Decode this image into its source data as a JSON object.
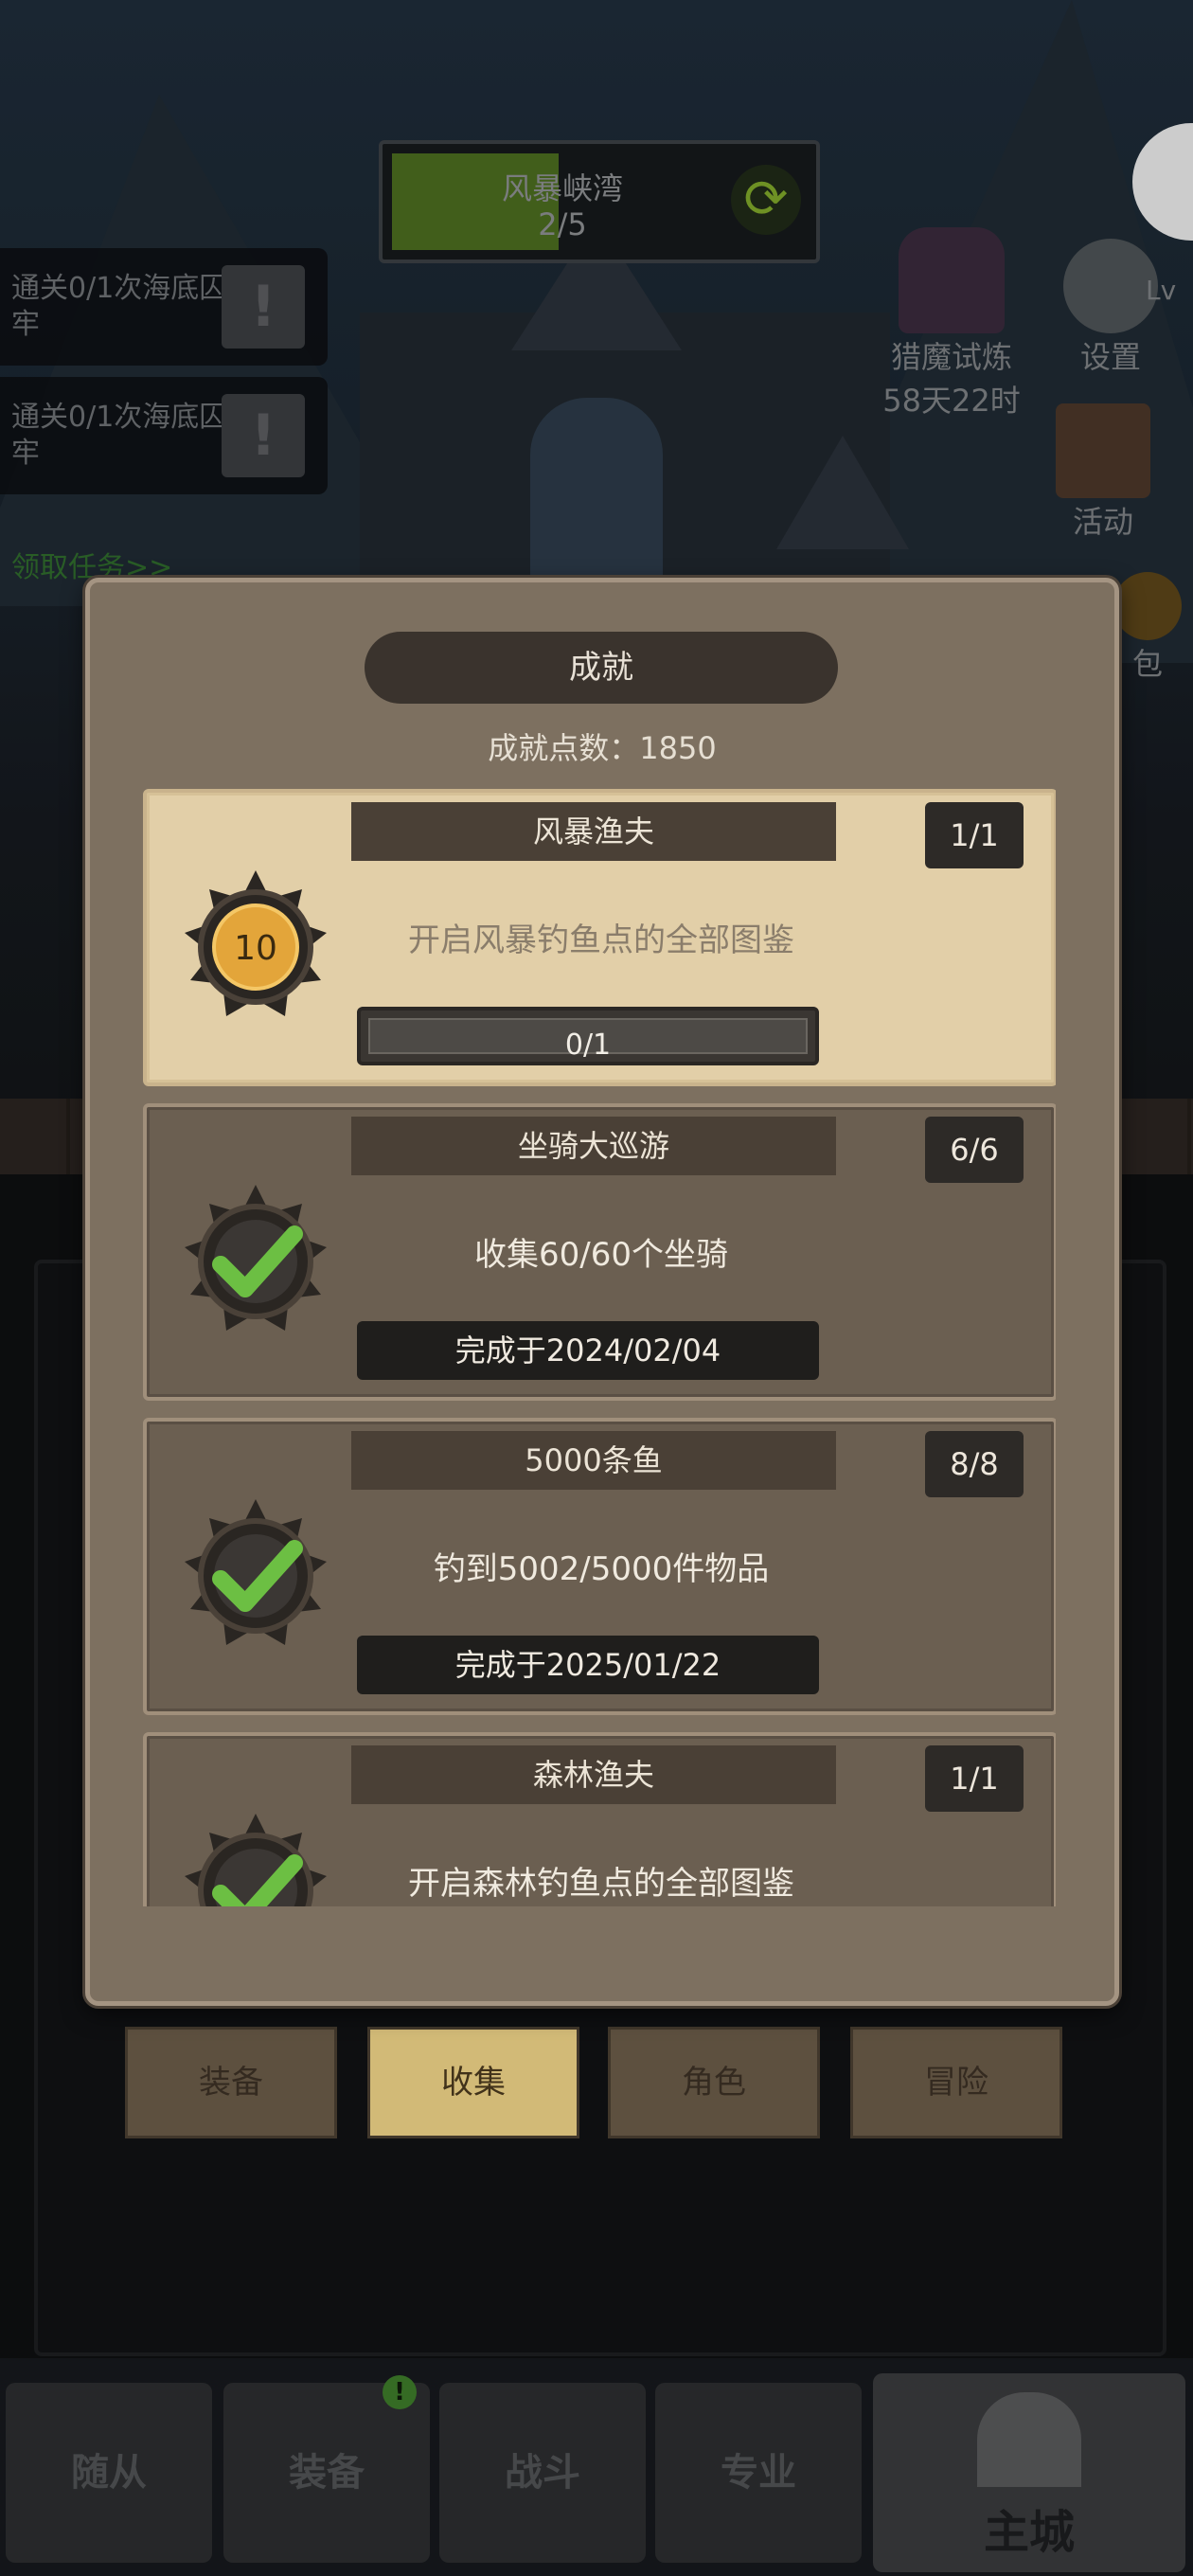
{
  "hud": {
    "map_name": "风暴峡湾",
    "map_progress": "2/5",
    "map_progress_fraction": 0.4,
    "quests": [
      {
        "text": "通关0/1次海底囚牢"
      },
      {
        "text": "通关0/1次海底囚牢"
      }
    ],
    "quest_link": "领取任务>>",
    "trial": {
      "name": "猎魔试炼",
      "time": "58天22时"
    },
    "settings_label": "设置",
    "activity_label": "活动",
    "level_prefix": "Lv",
    "bag_partial_label": "包"
  },
  "modal": {
    "title": "成就",
    "points_label": "成就点数：",
    "points_value": "1850",
    "achievements": [
      {
        "title": "风暴渔夫",
        "count": "1/1",
        "description": "开启风暴钓鱼点的全部图鉴",
        "state": "in-progress",
        "medal_value": "10",
        "progress_text": "0/1",
        "progress_fraction": 0
      },
      {
        "title": "坐骑大巡游",
        "count": "6/6",
        "description": "收集60/60个坐骑",
        "state": "completed",
        "completed_text": "完成于2024/02/04"
      },
      {
        "title": "5000条鱼",
        "count": "8/8",
        "description": "钓到5002/5000件物品",
        "state": "completed",
        "completed_text": "完成于2025/01/22"
      },
      {
        "title": "森林渔夫",
        "count": "1/1",
        "description": "开启森林钓鱼点的全部图鉴",
        "state": "completed"
      }
    ]
  },
  "subtabs": [
    {
      "label": "装备",
      "active": false
    },
    {
      "label": "收集",
      "active": true
    },
    {
      "label": "角色",
      "active": false
    },
    {
      "label": "冒险",
      "active": false
    }
  ],
  "nav": {
    "tabs": [
      {
        "label": "随从"
      },
      {
        "label": "装备"
      },
      {
        "label": "战斗"
      },
      {
        "label": "专业"
      }
    ],
    "badge": "!",
    "main_city_label": "主城"
  },
  "colors": {
    "card_highlight": "#e2cfa8",
    "card_normal": "#6b5f51",
    "check_green": "#6cbf43",
    "subtab_active": "#f0d488"
  }
}
